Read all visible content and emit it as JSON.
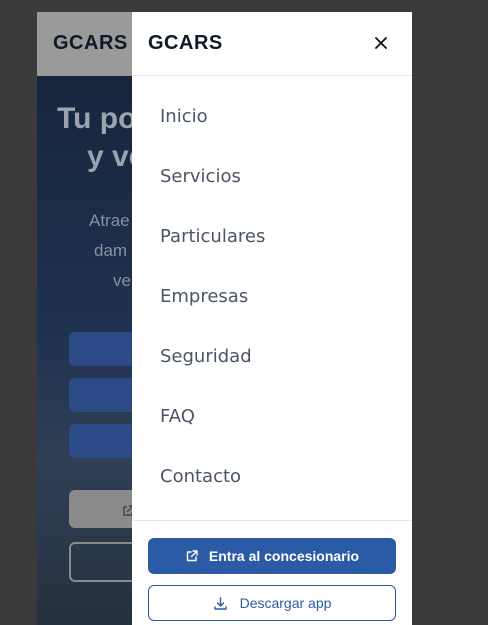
{
  "page": {
    "logo": "GCARS",
    "hero_title_line1": "Tu po",
    "hero_title_line2": "y ve",
    "hero_sub_lines": [
      "Atrae",
      "dam",
      "ve"
    ]
  },
  "drawer": {
    "logo": "GCARS",
    "close_label": "×",
    "nav_items": [
      {
        "label": "Inicio"
      },
      {
        "label": "Servicios"
      },
      {
        "label": "Particulares"
      },
      {
        "label": "Empresas"
      },
      {
        "label": "Seguridad"
      },
      {
        "label": "FAQ"
      },
      {
        "label": "Contacto"
      }
    ],
    "primary_button": {
      "label": "Entra al concesionario",
      "icon": "external-link-icon"
    },
    "secondary_button": {
      "label": "Descargar app",
      "icon": "download-icon"
    }
  },
  "colors": {
    "accent": "#2b5ba5",
    "overlay": "#3a393c",
    "text": "#4b5563"
  }
}
